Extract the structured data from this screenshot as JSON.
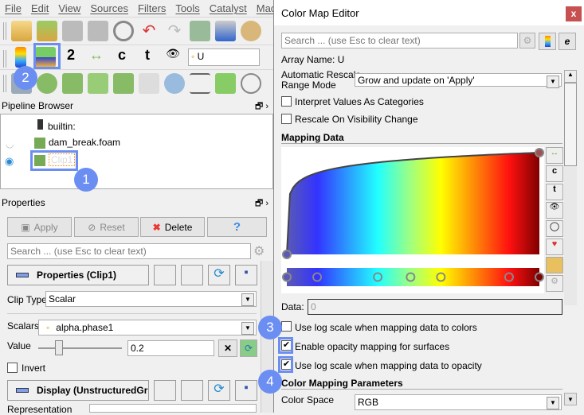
{
  "menu": [
    "File",
    "Edit",
    "View",
    "Sources",
    "Filters",
    "Tools",
    "Catalyst",
    "Macros"
  ],
  "toolbar": {
    "array_selector": "U"
  },
  "pipeline": {
    "title": "Pipeline Browser",
    "items": [
      "builtin:",
      "dam_break.foam",
      "Clip1"
    ]
  },
  "properties": {
    "title": "Properties",
    "apply": "Apply",
    "reset": "Reset",
    "delete": "Delete",
    "help": "?",
    "search_placeholder": "Search ... (use Esc to clear text)",
    "section1": "Properties (Clip1)",
    "clip_type_label": "Clip Type",
    "clip_type": "Scalar",
    "scalars_label": "Scalars",
    "scalars": "alpha.phase1",
    "value_label": "Value",
    "value": "0.2",
    "slider_fraction": 0.25,
    "invert_label": "Invert",
    "invert": false,
    "section2": "Display (UnstructuredGr",
    "representation_label": "Representation"
  },
  "editor": {
    "title": "Color Map Editor",
    "close": "x",
    "search_placeholder": "Search ... (use Esc to clear text)",
    "array_name": "Array Name: U",
    "rescale_label_1": "Automatic Rescale",
    "rescale_label_2": "Range Mode",
    "rescale_mode": "Grow and update on 'Apply'",
    "interpret_categories": "Interpret Values As Categories",
    "rescale_visibility": "Rescale On Visibility Change",
    "mapping_data": "Mapping Data",
    "data_label": "Data:",
    "data_value": "0",
    "log_colors": "Use log scale when mapping data to colors",
    "log_colors_checked": false,
    "opacity_mapping": "Enable opacity mapping for surfaces",
    "opacity_mapping_checked": true,
    "log_opacity": "Use log scale when mapping data to opacity",
    "log_opacity_checked": true,
    "params_title": "Color Mapping Parameters",
    "color_space_label": "Color Space",
    "color_space": "RGB",
    "colormap_colors": [
      "#5a5ab4",
      "#3333ff",
      "#22ffff",
      "#a0ff80",
      "#ffff00",
      "#ff1010",
      "#800000"
    ]
  },
  "badges": [
    "1",
    "2",
    "3",
    "4"
  ],
  "colors": {
    "accent": "#6b8ef2",
    "close": "#c75050"
  }
}
